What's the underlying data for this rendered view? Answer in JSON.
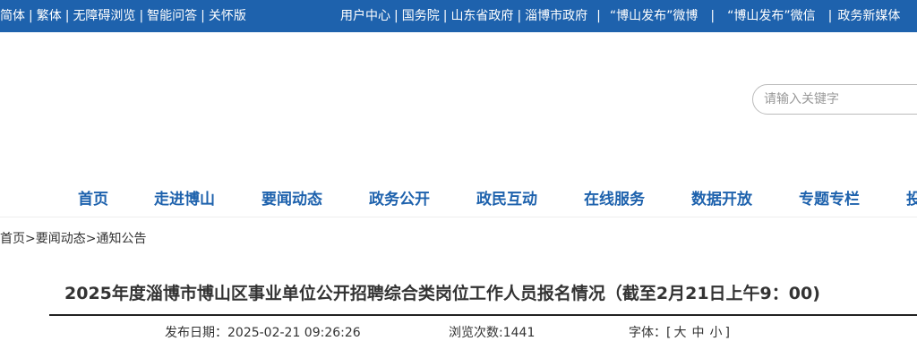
{
  "topbar": {
    "left_links": [
      "简体",
      "繁体",
      "无障碍浏览",
      "智能问答",
      "关怀版"
    ],
    "right_links": [
      "用户中心",
      "国务院",
      "山东省政府",
      "淄博市政府",
      "“博山发布”微博",
      "“博山发布”微信",
      "政务新媒体"
    ]
  },
  "search": {
    "placeholder": "请输入关键字"
  },
  "nav": {
    "items": [
      "首页",
      "走进博山",
      "要闻动态",
      "政务公开",
      "政民互动",
      "在线服务",
      "数据开放",
      "专题专栏",
      "投"
    ]
  },
  "breadcrumb": {
    "items": [
      "首页",
      "要闻动态",
      "通知公告"
    ],
    "separator": ">"
  },
  "article": {
    "title": "2025年度淄博市博山区事业单位公开招聘综合类岗位工作人员报名情况（截至2月21日上午9：00)",
    "publish_label": "发布日期：",
    "publish_date": "2025-02-21 09:26:26",
    "views_label": "浏览次数:",
    "views": "1441",
    "font_label": "字体：",
    "font_open": "[",
    "font_sizes": [
      "大",
      "中",
      "小"
    ],
    "font_close": "]"
  },
  "colors": {
    "topbar_bg": "#1e62ad",
    "nav_text": "#1e62ad"
  }
}
